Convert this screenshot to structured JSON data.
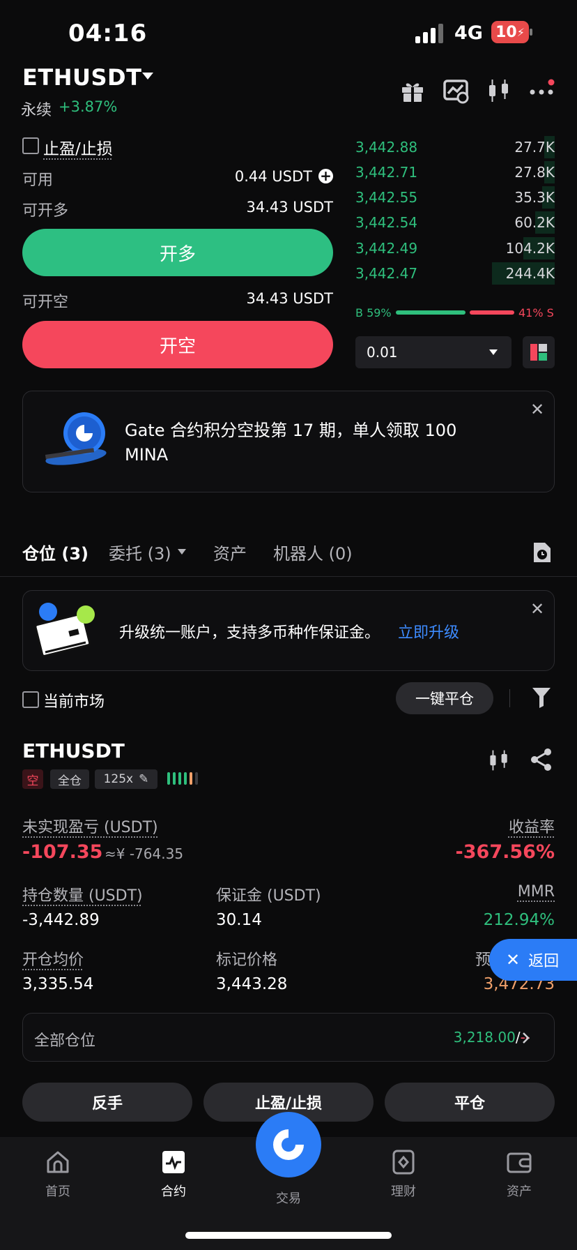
{
  "status_bar": {
    "time": "04:16",
    "network": "4G",
    "battery": "10"
  },
  "header": {
    "pair": "ETHUSDT",
    "contract_type": "永续",
    "change": "+3.87%"
  },
  "trade_panel": {
    "tp_sl_label": "止盈/止损",
    "available_label": "可用",
    "available_value": "0.44 USDT",
    "long_open_label": "可开多",
    "long_open_value": "34.43 USDT",
    "long_button": "开多",
    "short_open_label": "可开空",
    "short_open_value": "34.43 USDT",
    "short_button": "开空"
  },
  "order_book": {
    "rows": [
      {
        "price": "3,442.88",
        "qty": "27.7K",
        "depth": 0.15
      },
      {
        "price": "3,442.71",
        "qty": "27.8K",
        "depth": 0.15
      },
      {
        "price": "3,442.55",
        "qty": "35.3K",
        "depth": 0.18
      },
      {
        "price": "3,442.54",
        "qty": "60.2K",
        "depth": 0.28
      },
      {
        "price": "3,442.49",
        "qty": "104.2K",
        "depth": 0.45
      },
      {
        "price": "3,442.47",
        "qty": "244.4K",
        "depth": 0.9
      }
    ],
    "buy_label": "B 59%",
    "sell_label": "41% S",
    "buy_ratio": 0.59,
    "precision": "0.01"
  },
  "promo_banner": {
    "line1": "Gate 合约积分空投第 17 期，单人领取 100",
    "line2": "MINA"
  },
  "tabs": [
    {
      "label": "仓位 (3)"
    },
    {
      "label": "委托 (3)"
    },
    {
      "label": "资产"
    },
    {
      "label": "机器人 (0)"
    }
  ],
  "upgrade_banner": {
    "text": "升级统一账户，支持多币种作保证金。",
    "link": "立即升级"
  },
  "filter": {
    "current_market_label": "当前市场",
    "close_all_label": "一键平仓"
  },
  "position": {
    "symbol": "ETHUSDT",
    "side_tag": "空",
    "margin_mode_tag": "全仓",
    "leverage_tag": "125x",
    "unrealized_pnl_label": "未实现盈亏 (USDT)",
    "unrealized_pnl_value": "-107.35",
    "unrealized_pnl_cny": "≈¥ -764.35",
    "roe_label": "收益率",
    "roe_value": "-367.56%",
    "qty_label": "持仓数量 (USDT)",
    "qty_value": "-3,442.89",
    "margin_label": "保证金 (USDT)",
    "margin_value": "30.14",
    "mmr_label": "MMR",
    "mmr_value": "212.94%",
    "entry_label": "开仓均价",
    "entry_value": "3,335.54",
    "mark_label": "标记价格",
    "mark_value": "3,443.28",
    "liq_label": "预",
    "liq_value": "3,472.73",
    "all_positions_label": "全部仓位",
    "all_positions_value": "3,218.00",
    "all_positions_sep": "/",
    "all_positions_dash": "--"
  },
  "back_button": {
    "label": "返回"
  },
  "actions": {
    "reverse": "反手",
    "tp_sl": "止盈/止损",
    "close": "平仓"
  },
  "bottom_nav": [
    {
      "label": "首页"
    },
    {
      "label": "合约"
    },
    {
      "label": "交易"
    },
    {
      "label": "理财"
    },
    {
      "label": "资产"
    }
  ],
  "colors": {
    "green": "#2fbf7d",
    "red": "#f5475c",
    "accent_blue": "#2b7cf6",
    "orange": "#f0a06a"
  }
}
